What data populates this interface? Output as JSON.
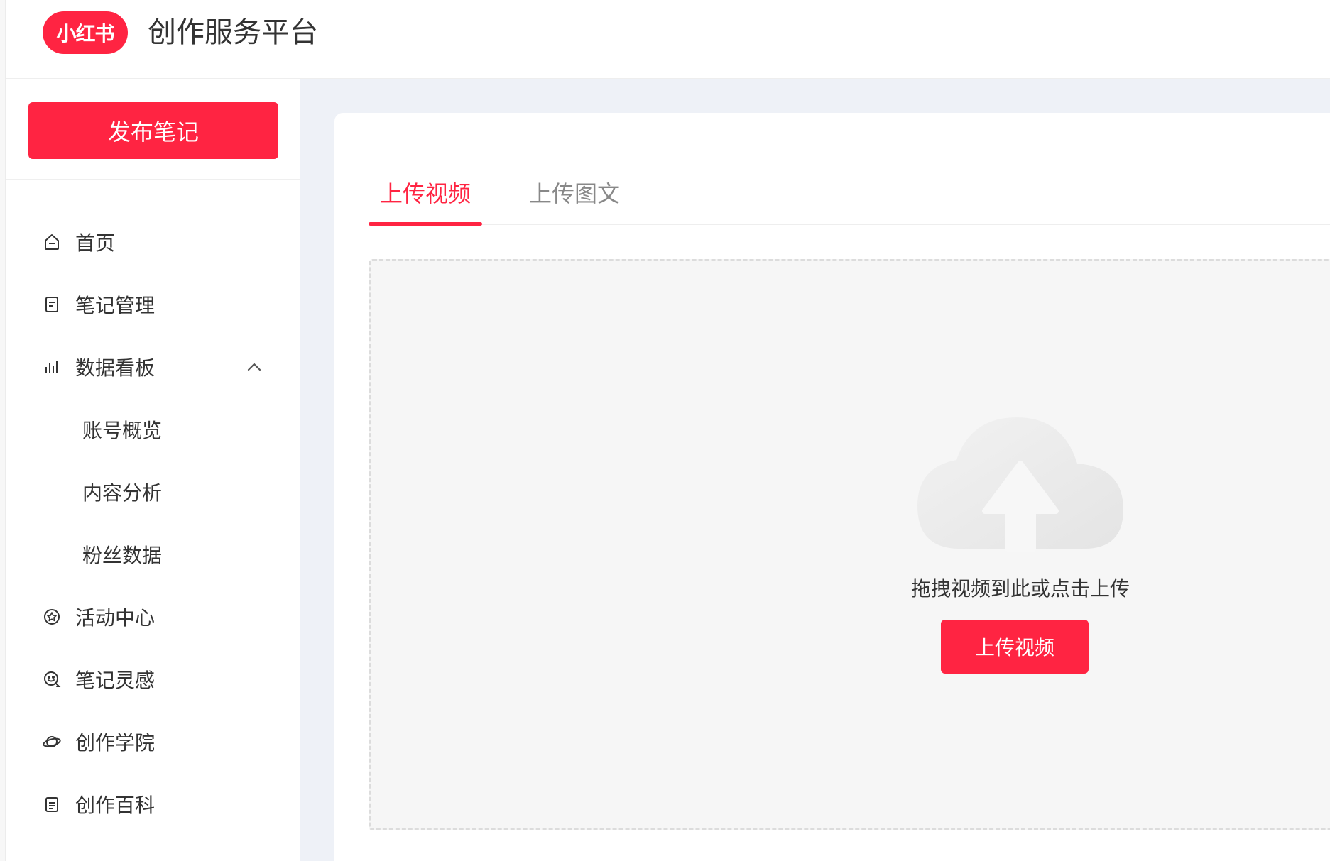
{
  "header": {
    "logo_text": "小红书",
    "platform_title": "创作服务平台"
  },
  "sidebar": {
    "publish_label": "发布笔记",
    "items": [
      {
        "label": "首页",
        "icon": "home-icon"
      },
      {
        "label": "笔记管理",
        "icon": "note-icon"
      },
      {
        "label": "数据看板",
        "icon": "bar-chart-icon",
        "expanded": true
      },
      {
        "label": "账号概览",
        "sub": true
      },
      {
        "label": "内容分析",
        "sub": true
      },
      {
        "label": "粉丝数据",
        "sub": true
      },
      {
        "label": "活动中心",
        "icon": "star-badge-icon"
      },
      {
        "label": "笔记灵感",
        "icon": "inspiration-icon"
      },
      {
        "label": "创作学院",
        "icon": "planet-icon"
      },
      {
        "label": "创作百科",
        "icon": "document-icon"
      }
    ]
  },
  "main": {
    "tabs": [
      {
        "label": "上传视频",
        "active": true
      },
      {
        "label": "上传图文",
        "active": false
      }
    ],
    "drop_hint": "拖拽视频到此或点击上传",
    "upload_button_label": "上传视频"
  },
  "colors": {
    "brand": "#ff2442",
    "background": "#eef1f7",
    "drop_zone": "#f6f6f6"
  }
}
